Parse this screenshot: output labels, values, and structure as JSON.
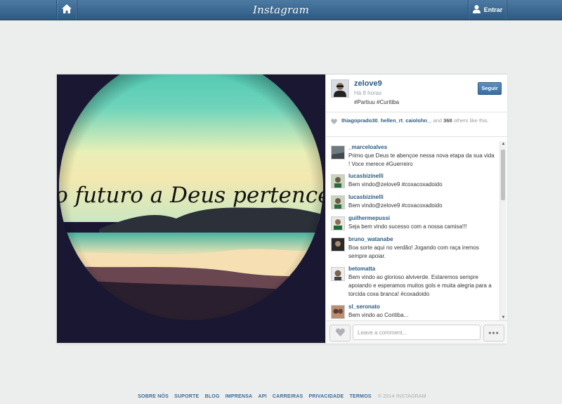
{
  "header": {
    "logo": "Instagram",
    "login_label": "Entrar"
  },
  "post": {
    "image_text": "E o futuro a Deus pertence.",
    "owner": {
      "username": "zelove9",
      "time": "Há 8 horas",
      "caption": "#Partiuu #Curitiba"
    },
    "follow_label": "Seguir",
    "likes": {
      "users": [
        "thiagoprado30",
        "hellen_rt",
        "caiolohn_"
      ],
      "and_label": ", and",
      "count": "368",
      "suffix": "others like this."
    },
    "comments": [
      {
        "user": "_marceloalves",
        "text": "Primo que Deus te abençoe nessa nova etapa da sua vida ! Voce merece #Guerreiro"
      },
      {
        "user": "lucasbizinelli",
        "text": "Bem vindo@zelove9 #coxacoxadoido"
      },
      {
        "user": "lucasbizinelli",
        "text": "Bem vindo@zelove9 #coxacoxadoido"
      },
      {
        "user": "guilhermepussi",
        "text": "Seja bem vindo sucesso com a nossa camisa!!!"
      },
      {
        "user": "bruno_watanabe",
        "text": "Boa sorte aqui no verdão! Jogando com raça iremos sempre apoiar."
      },
      {
        "user": "betomatta",
        "text": "Bem vindo ao glorioso alviverde. Estaremos sempre apoiando e esperamos muitos gols e muita alegria para a torcida coxa branca! #coxadoido"
      },
      {
        "user": "sl_seronato",
        "text": "Bem vindo ao Coritiba..."
      }
    ],
    "comment_placeholder": "Leave a comment..."
  },
  "footer": {
    "links": [
      "SOBRE NÓS",
      "SUPORTE",
      "BLOG",
      "IMPRENSA",
      "API",
      "CARREIRAS",
      "PRIVACIDADE",
      "TERMOS"
    ],
    "copyright": "© 2014 INSTAGRAM"
  },
  "icons": {
    "home": "home-icon",
    "user": "user-icon",
    "heart": "heart-icon",
    "more": "more-icon"
  },
  "colors": {
    "header": "#3b6a95",
    "link": "#2c5a83",
    "background": "#eceeee"
  }
}
